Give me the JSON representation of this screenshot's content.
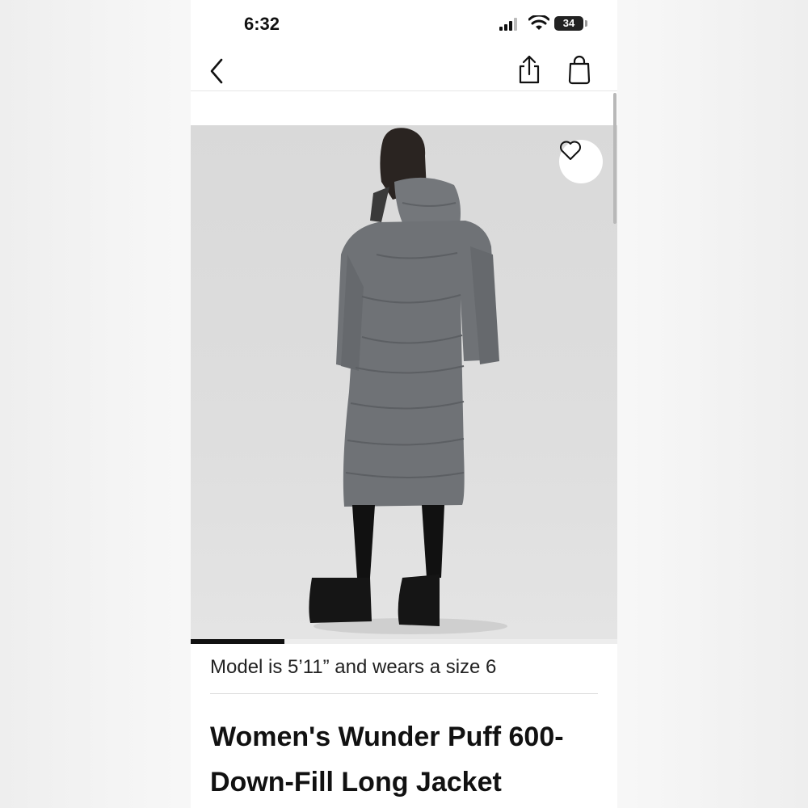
{
  "status_bar": {
    "time": "6:32",
    "battery": "34"
  },
  "nav": {
    "back_icon": "chevron-left-icon",
    "share_icon": "share-icon",
    "bag_icon": "shopping-bag-icon"
  },
  "gallery": {
    "favorite_icon": "heart-icon",
    "progress": 0.22,
    "model_note": "Model is 5’11” and wears a size 6"
  },
  "product": {
    "title": "Women's Wunder Puff 600-Down-Fill Long Jacket"
  },
  "colors": {
    "accent": "#111111",
    "jacket": "#6f7276",
    "background": "#dddddd"
  }
}
